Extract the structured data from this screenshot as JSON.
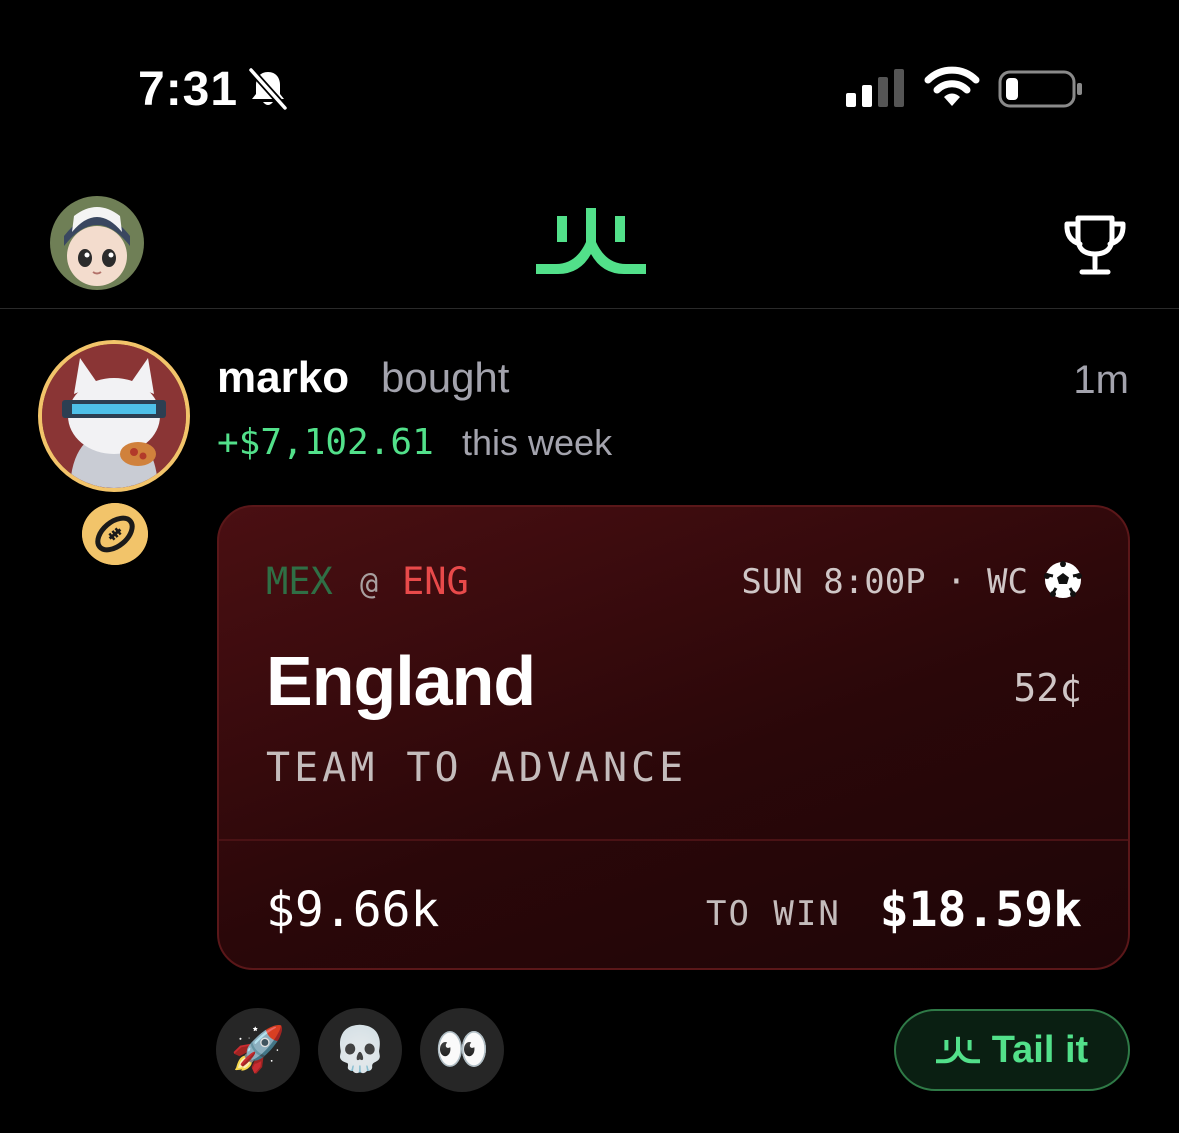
{
  "status_bar": {
    "time": "7:31"
  },
  "post": {
    "username": "marko",
    "action": "bought",
    "time_ago": "1m",
    "weekly_gain": "+$7,102.61",
    "weekly_label": "this week",
    "card": {
      "away_team": "MEX",
      "at": "@",
      "home_team": "ENG",
      "meta": "SUN 8:00P · WC",
      "pick": "England",
      "price": "52¢",
      "market": "TEAM TO ADVANCE",
      "stake": "$9.66k",
      "to_win_label": "TO WIN",
      "to_win": "$18.59k"
    },
    "reactions": [
      "🚀",
      "💀",
      "👀"
    ],
    "tail_button": "Tail it"
  },
  "colors": {
    "accent": "#52e08a",
    "badge": "#f2c46a",
    "card": "#2a0709",
    "eng": "#e84a4a",
    "mex": "#2f6f45"
  }
}
